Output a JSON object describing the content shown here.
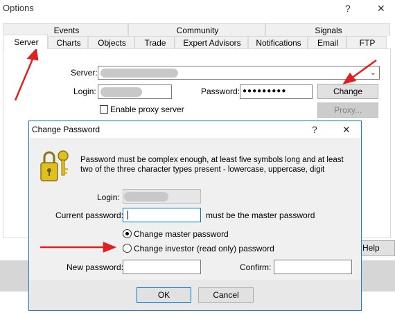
{
  "options": {
    "title": "Options",
    "help_icon": "?",
    "close_icon": "✕",
    "tabs_top": [
      "Events",
      "Community",
      "Signals"
    ],
    "tabs_bottom": [
      "Server",
      "Charts",
      "Objects",
      "Trade",
      "Expert Advisors",
      "Notifications",
      "Email",
      "FTP"
    ],
    "active_tab": "Server",
    "server_label": "Server:",
    "login_label": "Login:",
    "password_label": "Password:",
    "password_value": "●●●●●●●●●",
    "change_button": "Change",
    "proxy_button": "Proxy...",
    "proxy_checkbox_label": "Enable proxy server",
    "help_button": "Help"
  },
  "dialog": {
    "title": "Change Password",
    "help_icon": "?",
    "close_icon": "✕",
    "message": "Password must be complex enough, at least five symbols long and at least two of the three character types present - lowercase, uppercase, digit",
    "login_label": "Login:",
    "current_password_label": "Current password:",
    "current_password_hint": "must be the master password",
    "radio_master": "Change master password",
    "radio_investor": "Change investor (read only) password",
    "selected_radio": "master",
    "new_password_label": "New password:",
    "confirm_label": "Confirm:",
    "ok_button": "OK",
    "cancel_button": "Cancel"
  },
  "colors": {
    "annotation_arrow": "#e02020",
    "dialog_border": "#1979ca",
    "keys_icon": "#d4b21a"
  }
}
